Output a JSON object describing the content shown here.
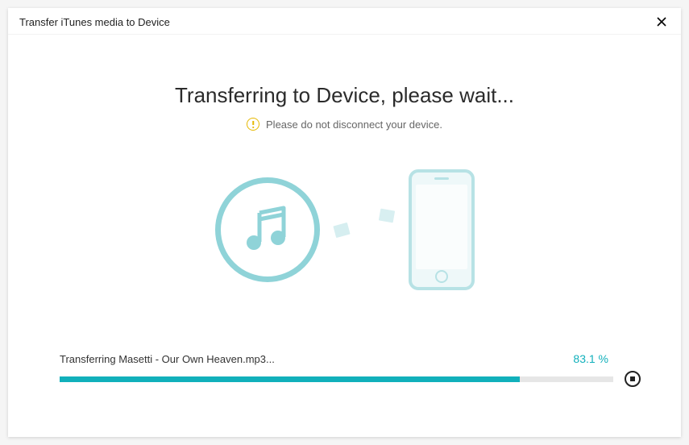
{
  "window": {
    "title": "Transfer iTunes media to Device"
  },
  "main": {
    "heading": "Transferring to Device, please wait...",
    "warning": "Please do not disconnect your device."
  },
  "progress": {
    "file_label": "Transferring Masetti - Our Own Heaven.mp3...",
    "percent_label": "83.1 %",
    "percent_value": 83.1
  },
  "colors": {
    "accent": "#11b0bb",
    "illustration": "#8fd3d8",
    "warning": "#e6b800"
  }
}
